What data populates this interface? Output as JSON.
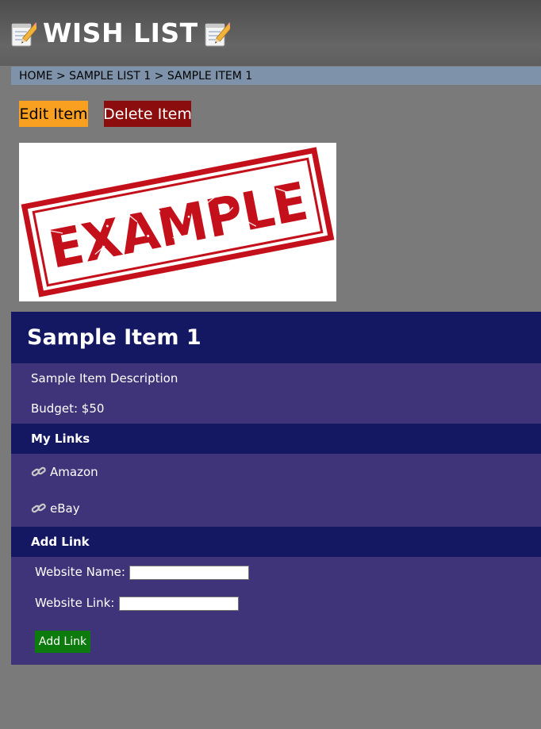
{
  "header": {
    "title": "WISH LIST",
    "left_icon": "memo-icon",
    "right_icon": "memo-icon"
  },
  "breadcrumb": {
    "items": [
      "HOME",
      "SAMPLE LIST 1",
      "SAMPLE ITEM 1"
    ],
    "separator": ">"
  },
  "actions": {
    "edit_label": "Edit Item",
    "delete_label": "Delete Item"
  },
  "image": {
    "stamp_text": "EXAMPLE"
  },
  "item": {
    "title": "Sample Item 1",
    "description": "Sample Item Description",
    "budget": "Budget: $50"
  },
  "links_section": {
    "title": "My Links",
    "links": [
      {
        "label": "Amazon",
        "icon": "link-icon"
      },
      {
        "label": "eBay",
        "icon": "link-icon"
      }
    ]
  },
  "add_link_form": {
    "title": "Add Link",
    "name_label": "Website Name:",
    "name_value": "",
    "url_label": "Website Link:",
    "url_value": "",
    "submit_label": "Add Link"
  },
  "colors": {
    "header_bg": "#5a5a5a",
    "breadcrumb_bg": "#7e93aa",
    "edit_button": "#f9a021",
    "delete_button": "#8b0d0d",
    "panel_bg": "#3f3479",
    "panel_header": "#141762",
    "add_button": "#0c7a0c",
    "page_bg": "#7a7a7a",
    "stamp_red": "#c4101a"
  }
}
